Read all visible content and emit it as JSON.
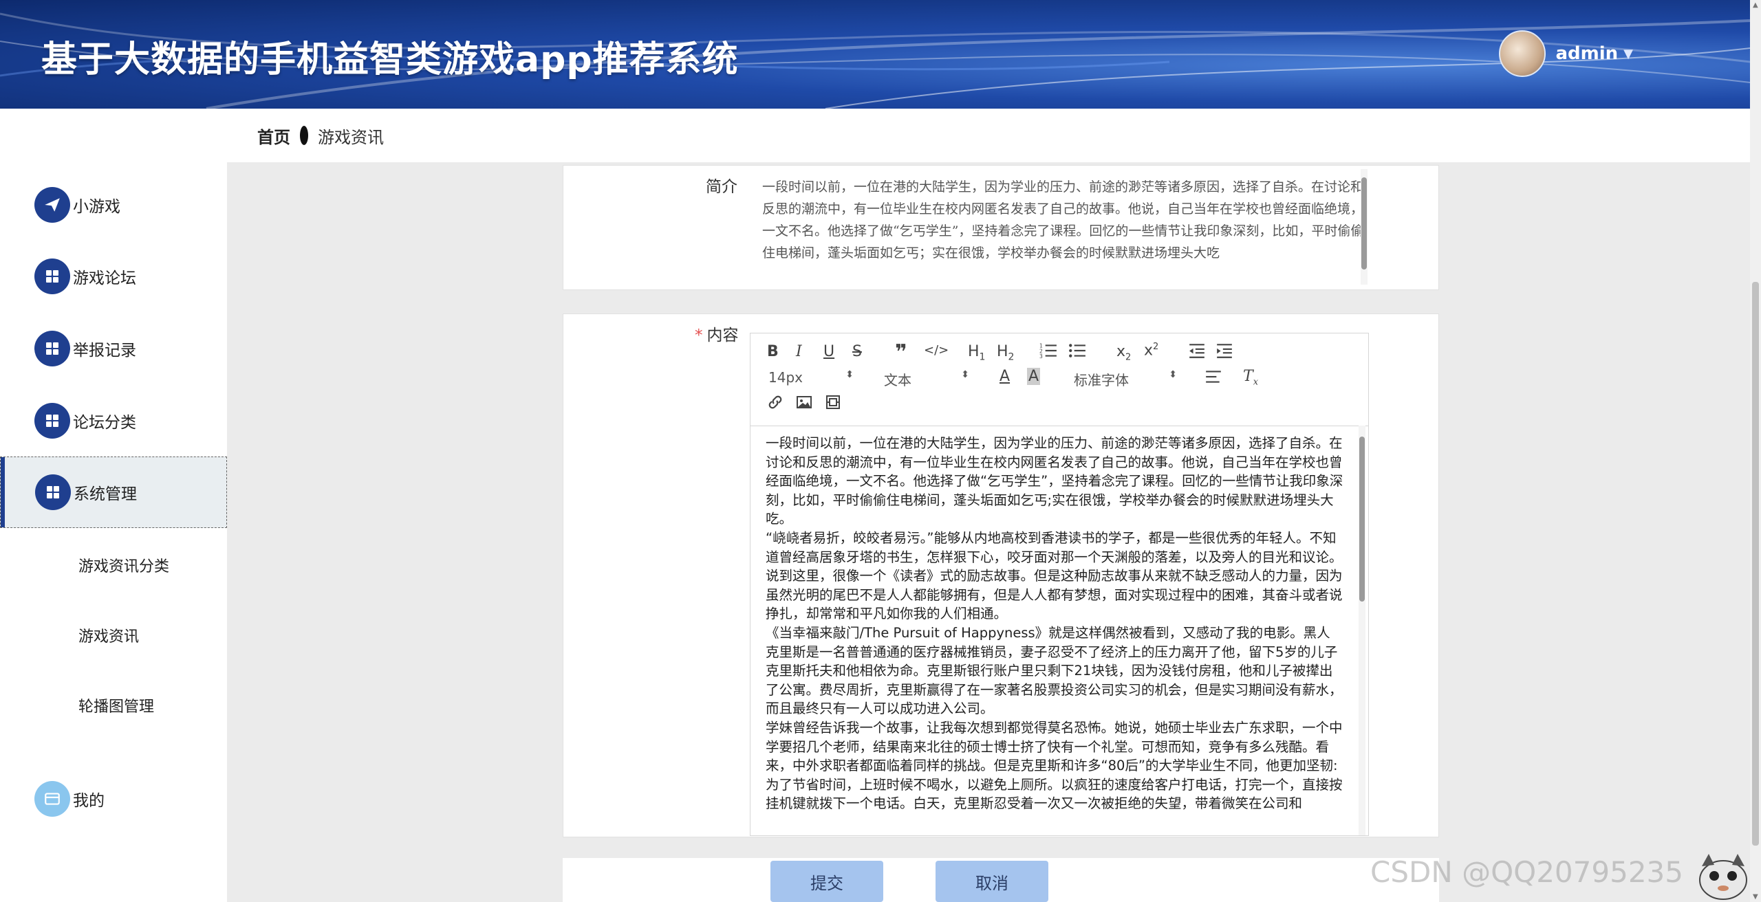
{
  "header": {
    "title": "基于大数据的手机益智类游戏app推荐系统",
    "username": "admin"
  },
  "breadcrumb": {
    "home": "首页",
    "current": "游戏资讯"
  },
  "sidebar": {
    "items": [
      {
        "label": "小游戏",
        "icon": "paper-plane-icon"
      },
      {
        "label": "游戏论坛",
        "icon": "grid-icon"
      },
      {
        "label": "举报记录",
        "icon": "grid-icon"
      },
      {
        "label": "论坛分类",
        "icon": "grid-icon"
      },
      {
        "label": "系统管理",
        "icon": "grid-icon",
        "active": true
      }
    ],
    "sub_items": [
      "游戏资讯分类",
      "游戏资讯",
      "轮播图管理"
    ],
    "mine": {
      "label": "我的",
      "icon": "card-icon"
    }
  },
  "form": {
    "intro_label": "简介",
    "intro_text": "一段时间以前，一位在港的大陆学生，因为学业的压力、前途的渺茫等诸多原因，选择了自杀。在讨论和反思的潮流中，有一位毕业生在校内网匿名发表了自己的故事。他说，自己当年在学校也曾经面临绝境，一文不名。他选择了做“乞丐学生”，坚持着念完了课程。回忆的一些情节让我印象深刻，比如，平时偷偷住电梯间，蓬头垢面如乞丐；实在很饿，学校举办餐会的时候默默进场埋头大吃",
    "content_label": "内容",
    "toolbar": {
      "font_size": "14px",
      "text_style": "文本",
      "font_family": "标准字体"
    },
    "content_paragraphs": [
      "一段时间以前，一位在港的大陆学生，因为学业的压力、前途的渺茫等诸多原因，选择了自杀。在讨论和反思的潮流中，有一位毕业生在校内网匿名发表了自己的故事。他说，自己当年在学校也曾经面临绝境，一文不名。他选择了做“乞丐学生”，坚持着念完了课程。回忆的一些情节让我印象深刻，比如，平时偷偷住电梯间，蓬头垢面如乞丐;实在很饿，学校举办餐会的时候默默进场埋头大吃。",
      "“峣峣者易折，皎皎者易污。”能够从内地高校到香港读书的学子，都是一些很优秀的年轻人。不知道曾经高居象牙塔的书生，怎样狠下心，咬牙面对那一个天渊般的落差，以及旁人的目光和议论。",
      "说到这里，很像一个《读者》式的励志故事。但是这种励志故事从来就不缺乏感动人的力量，因为虽然光明的尾巴不是人人都能够拥有，但是人人都有梦想，面对实现过程中的困难，其奋斗或者说挣扎，却常常和平凡如你我的人们相通。",
      "《当幸福来敲门/The Pursuit of Happyness》就是这样偶然被看到，又感动了我的电影。黑人克里斯是一名普普通通的医疗器械推销员，妻子忍受不了经济上的压力离开了他，留下5岁的儿子克里斯托夫和他相依为命。克里斯银行账户里只剩下21块钱，因为没钱付房租，他和儿子被撵出了公寓。费尽周折，克里斯赢得了在一家著名股票投资公司实习的机会，但是实习期间没有薪水，而且最终只有一人可以成功进入公司。",
      "学妹曾经告诉我一个故事，让我每次想到都觉得莫名恐怖。她说，她硕士毕业去广东求职，一个中学要招几个老师，结果南来北往的硕士博士挤了快有一个礼堂。可想而知，竞争有多么残酷。看来，中外求职者都面临着同样的挑战。但是克里斯和许多“80后”的大学毕业生不同，他更加坚韧:为了节省时间，上班时候不喝水，以避免上厕所。以疯狂的速度给客户打电话，打完一个，直接按挂机键就拨下一个电话。白天，克里斯忍受着一次又一次被拒绝的失望，带着微笑在公司和"
    ]
  },
  "buttons": {
    "submit": "提交",
    "cancel": "取消"
  },
  "watermark": "CSDN @QQ20795235",
  "colors": {
    "nav_icon": "#1f3f8f",
    "button": "#a5c4ee",
    "required": "#e35050"
  }
}
